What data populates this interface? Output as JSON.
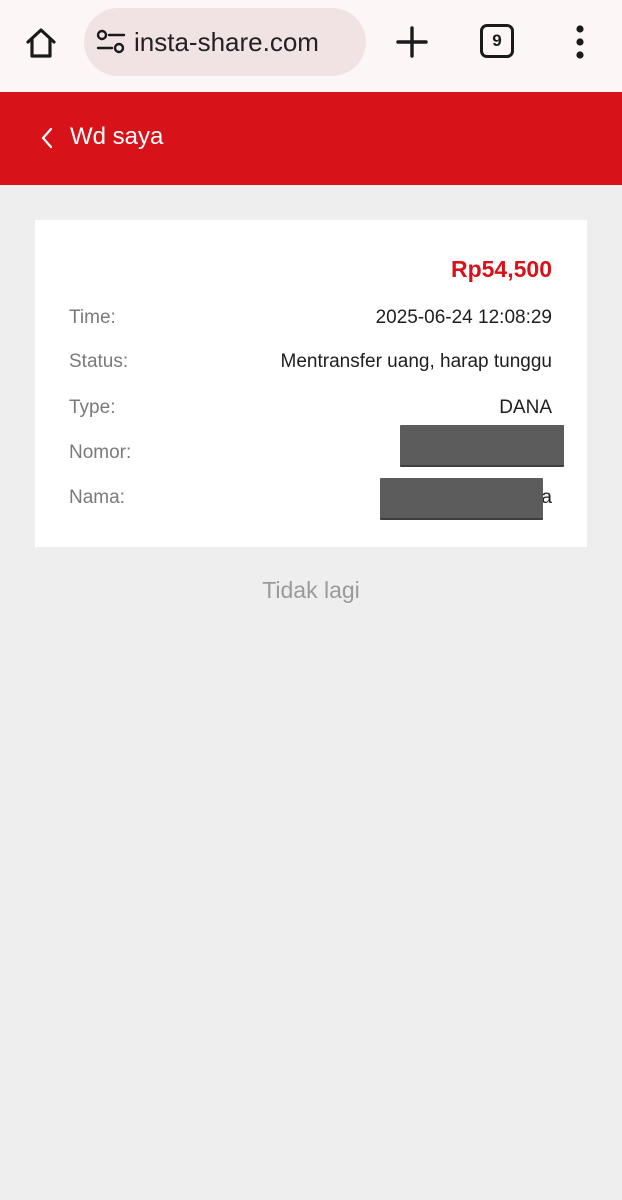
{
  "browser": {
    "url": "insta-share.com",
    "tab_count": "9",
    "icons": [
      "home-icon",
      "site-settings-icon",
      "plus-icon",
      "tab-switcher-icon",
      "more-vert-icon"
    ]
  },
  "header": {
    "title": "Wd saya",
    "color": "#d81219"
  },
  "withdrawal": {
    "amount": "Rp54,500",
    "rows": [
      {
        "label": "Time:",
        "value": "2025-06-24 12:08:29"
      },
      {
        "label": "Status:",
        "value": "Mentransfer uang, harap tunggu"
      },
      {
        "label": "Type:",
        "value": "DANA"
      },
      {
        "label": "Nomor:",
        "value": ""
      },
      {
        "label": "Nama:",
        "value": "a"
      }
    ]
  },
  "footer": {
    "no_more_text": "Tidak lagi"
  }
}
